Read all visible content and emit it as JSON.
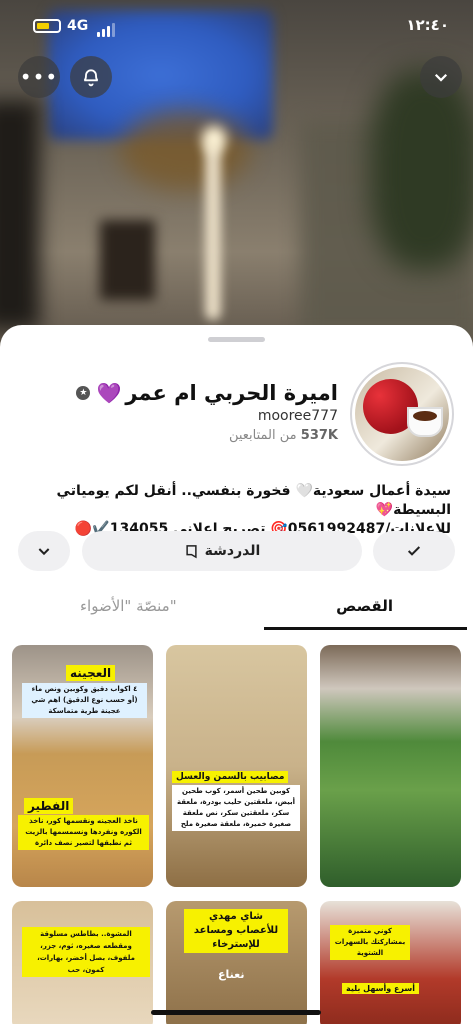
{
  "status": {
    "time": "١٢:٤٠",
    "network": "4G"
  },
  "profile": {
    "name": "اميرة الحربي ام عمر",
    "username": "mooree777",
    "followers_count": "537K",
    "followers_label": "من المتابعين",
    "bio_line1": "سيدة أعمال سعودية🤍 فخورة بنفسي.. أنقل لكم يومياتي البسيطة💖",
    "bio_line2": "للإعلانات/0561992487🎯 تصريح اعلاني 134055✔️🔴"
  },
  "actions": {
    "chat_label": "الدردشة"
  },
  "tabs": {
    "stories": "القصص",
    "spotlight": "منصّة \"الأضواء\""
  },
  "cards": [
    {
      "title": "العجينه",
      "caption": "٤ اكواب دقيق وكوبين ونص ماء (أو حسب نوع الدقيق) اهم شي عجينة طرية متماسكة",
      "title2": "الفطير",
      "caption2": "ناخذ العجينه ونقسمها كور، ناخذ الكوره ونفردها ونسمسمها بالزيت ثم نطبقها لتصير نصف دائرة"
    },
    {
      "title": "مصابيب بالسمن والعسل",
      "caption": "كوبين طحين أسمر، كوب طحين أبيض، ملعقتين حليب بودرة، ملعقة سكر، ملعقتين سكر، نص ملعقة صغيرة خميرة، ملعقة صغيرة ملح"
    },
    {
      "title": "",
      "caption": ""
    },
    {
      "title": "المشوة",
      "caption": "بطاطس مسلوقة ومقطعه صغيره، ثوم، جزر، ملفوف، بصل أخضر، بهارات، كمون، حب"
    },
    {
      "title": "شاي مهدي للأعصاب ومساعد للإسترخاء",
      "caption": "نعناع"
    },
    {
      "title": "أسرع وأسهل بلية",
      "caption": "كوني متميزة بمشاركتك بالسهرات الشتوية"
    }
  ]
}
